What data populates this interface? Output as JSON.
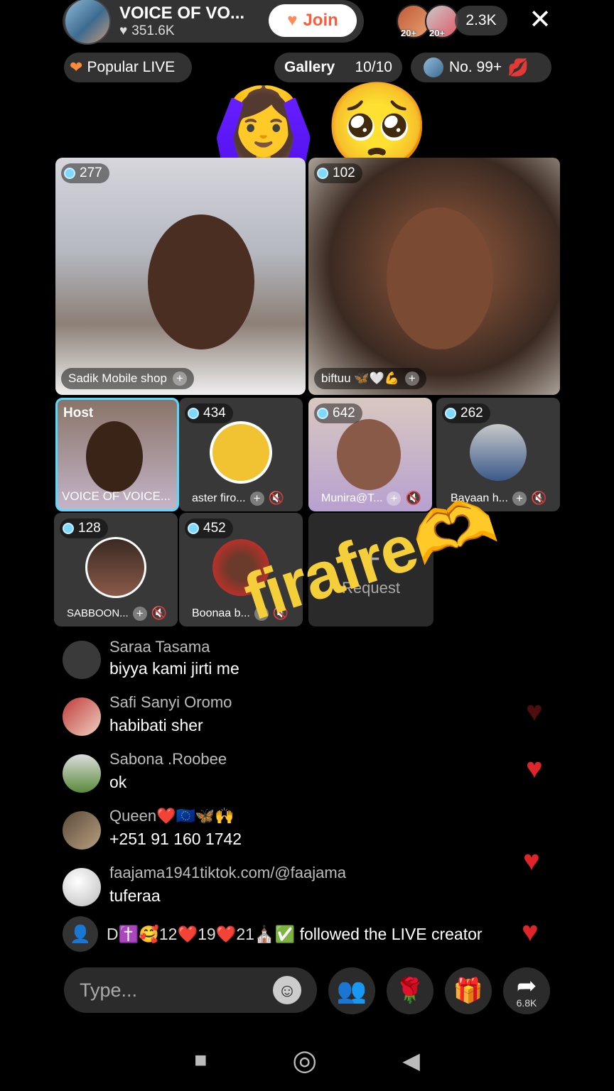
{
  "header": {
    "host_name": "VOICE OF VO...",
    "likes": "351.6K",
    "join_label": "Join",
    "viewer_badges": [
      "20+",
      "20+"
    ],
    "viewer_count": "2.3K"
  },
  "chips": {
    "popular": "Popular LIVE",
    "gallery": "Gallery",
    "gallery_count": "10/10",
    "rank": "No. 99+"
  },
  "decorations": {
    "emoji_left": "🙆‍♀️",
    "emoji_right": "🥺",
    "overlay_text": "firafre",
    "overlay_emoji": "🫶"
  },
  "tiles": {
    "big": [
      {
        "count": "277",
        "name": "Sadik Mobile shop"
      },
      {
        "count": "102",
        "name": "biftuu 🦋🤍💪"
      }
    ],
    "row1": [
      {
        "tag": "Host",
        "name": "VOICE OF VOICE..."
      },
      {
        "count": "434",
        "name": "aster firo..."
      },
      {
        "count": "642",
        "name": "Munira@T..."
      },
      {
        "count": "262",
        "name": "Bayaan h..."
      }
    ],
    "row2": [
      {
        "count": "128",
        "name": "SABBOON..."
      },
      {
        "count": "452",
        "name": "Boonaa b..."
      }
    ],
    "request_label": "Request"
  },
  "comments": [
    {
      "user": "Saraa Tasama",
      "msg": "biyya kami jirti me"
    },
    {
      "user": "Safi Sanyi Oromo",
      "msg": "habibati sher"
    },
    {
      "user": "Sabona .Roobee",
      "msg": "ok"
    },
    {
      "user": "Queen❤️🇪🇺🦋🙌",
      "msg": "+251 91 160 1742"
    },
    {
      "user": "faajama1941tiktok.com/@faajama",
      "msg": "tuferaa"
    }
  ],
  "follow_event": {
    "user": "D✝️🥰12❤️19❤️21⛪✅",
    "text": "followed the LIVE creator"
  },
  "bottom_bar": {
    "input_placeholder": "Type...",
    "share_count": "6.8K"
  },
  "colors": {
    "accent": "#ff5a3a",
    "heart": "#e0252a",
    "overlay_text": "#f4cf3a",
    "host_tile_border": "#5ad9ff"
  }
}
